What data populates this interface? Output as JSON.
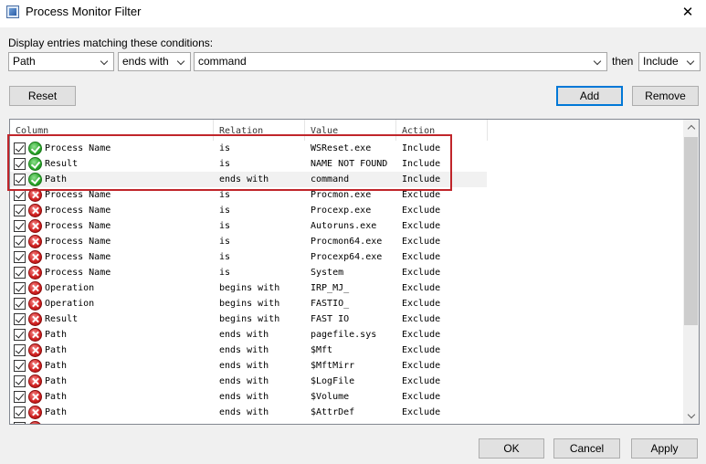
{
  "window": {
    "title": "Process Monitor Filter",
    "close_glyph": "✕"
  },
  "condition": {
    "label": "Display entries matching these conditions:",
    "column_value": "Path",
    "relation_value": "ends with",
    "value_text": "command",
    "then_label": "then",
    "action_value": "Include"
  },
  "buttons": {
    "reset": "Reset",
    "add": "Add",
    "remove": "Remove",
    "ok": "OK",
    "cancel": "Cancel",
    "apply": "Apply"
  },
  "list": {
    "headers": [
      "Column",
      "Relation",
      "Value",
      "Action"
    ],
    "rows": [
      {
        "column": "Process Name",
        "relation": "is",
        "value": "WSReset.exe",
        "action": "Include",
        "status": "include",
        "checked": true
      },
      {
        "column": "Result",
        "relation": "is",
        "value": "NAME NOT FOUND",
        "action": "Include",
        "status": "include",
        "checked": true
      },
      {
        "column": "Path",
        "relation": "ends with",
        "value": "command",
        "action": "Include",
        "status": "include",
        "checked": true,
        "selected": true
      },
      {
        "column": "Process Name",
        "relation": "is",
        "value": "Procmon.exe",
        "action": "Exclude",
        "status": "exclude",
        "checked": true
      },
      {
        "column": "Process Name",
        "relation": "is",
        "value": "Procexp.exe",
        "action": "Exclude",
        "status": "exclude",
        "checked": true
      },
      {
        "column": "Process Name",
        "relation": "is",
        "value": "Autoruns.exe",
        "action": "Exclude",
        "status": "exclude",
        "checked": true
      },
      {
        "column": "Process Name",
        "relation": "is",
        "value": "Procmon64.exe",
        "action": "Exclude",
        "status": "exclude",
        "checked": true
      },
      {
        "column": "Process Name",
        "relation": "is",
        "value": "Procexp64.exe",
        "action": "Exclude",
        "status": "exclude",
        "checked": true
      },
      {
        "column": "Process Name",
        "relation": "is",
        "value": "System",
        "action": "Exclude",
        "status": "exclude",
        "checked": true
      },
      {
        "column": "Operation",
        "relation": "begins with",
        "value": "IRP_MJ_",
        "action": "Exclude",
        "status": "exclude",
        "checked": true
      },
      {
        "column": "Operation",
        "relation": "begins with",
        "value": "FASTIO_",
        "action": "Exclude",
        "status": "exclude",
        "checked": true
      },
      {
        "column": "Result",
        "relation": "begins with",
        "value": "FAST IO",
        "action": "Exclude",
        "status": "exclude",
        "checked": true
      },
      {
        "column": "Path",
        "relation": "ends with",
        "value": "pagefile.sys",
        "action": "Exclude",
        "status": "exclude",
        "checked": true
      },
      {
        "column": "Path",
        "relation": "ends with",
        "value": "$Mft",
        "action": "Exclude",
        "status": "exclude",
        "checked": true
      },
      {
        "column": "Path",
        "relation": "ends with",
        "value": "$MftMirr",
        "action": "Exclude",
        "status": "exclude",
        "checked": true
      },
      {
        "column": "Path",
        "relation": "ends with",
        "value": "$LogFile",
        "action": "Exclude",
        "status": "exclude",
        "checked": true
      },
      {
        "column": "Path",
        "relation": "ends with",
        "value": "$Volume",
        "action": "Exclude",
        "status": "exclude",
        "checked": true
      },
      {
        "column": "Path",
        "relation": "ends with",
        "value": "$AttrDef",
        "action": "Exclude",
        "status": "exclude",
        "checked": true
      },
      {
        "column": "",
        "relation": "",
        "value": "",
        "action": "",
        "status": "exclude",
        "checked": true
      }
    ]
  },
  "colors": {
    "highlight_border": "#c0252a",
    "include_icon": "#2aa62a",
    "exclude_icon": "#d02020",
    "default_button_border": "#0078d7"
  }
}
